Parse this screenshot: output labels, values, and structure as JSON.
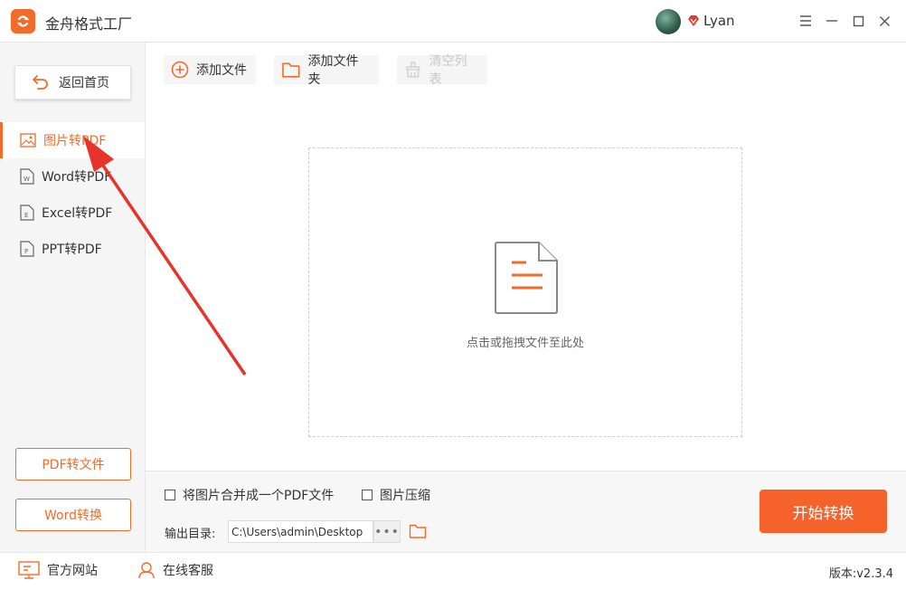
{
  "app": {
    "title": "金舟格式工厂",
    "accent": "#f26b2a"
  },
  "user": {
    "name": "Lyan"
  },
  "sidebar": {
    "back_label": "返回首页",
    "items": [
      {
        "label": "图片转PDF",
        "icon": "image-icon",
        "active": true
      },
      {
        "label": "Word转PDF",
        "icon": "word-doc-icon",
        "active": false
      },
      {
        "label": "Excel转PDF",
        "icon": "excel-doc-icon",
        "active": false
      },
      {
        "label": "PPT转PDF",
        "icon": "ppt-doc-icon",
        "active": false
      }
    ],
    "bottom_buttons": [
      "PDF转文件",
      "Word转换"
    ]
  },
  "toolbar": {
    "add_file": "添加文件",
    "add_folder": "添加文件夹",
    "clear_list": "清空列表"
  },
  "dropzone": {
    "hint": "点击或拖拽文件至此处"
  },
  "options": {
    "merge_label": "将图片合并成一个PDF文件",
    "merge_checked": false,
    "compress_label": "图片压缩",
    "compress_checked": false,
    "output_label": "输出目录:",
    "output_path": "C:\\Users\\admin\\Desktop",
    "browse_label": "•••"
  },
  "start_button": "开始转换",
  "statusbar": {
    "website": "官方网站",
    "support": "在线客服",
    "version": "版本:v2.3.4"
  }
}
